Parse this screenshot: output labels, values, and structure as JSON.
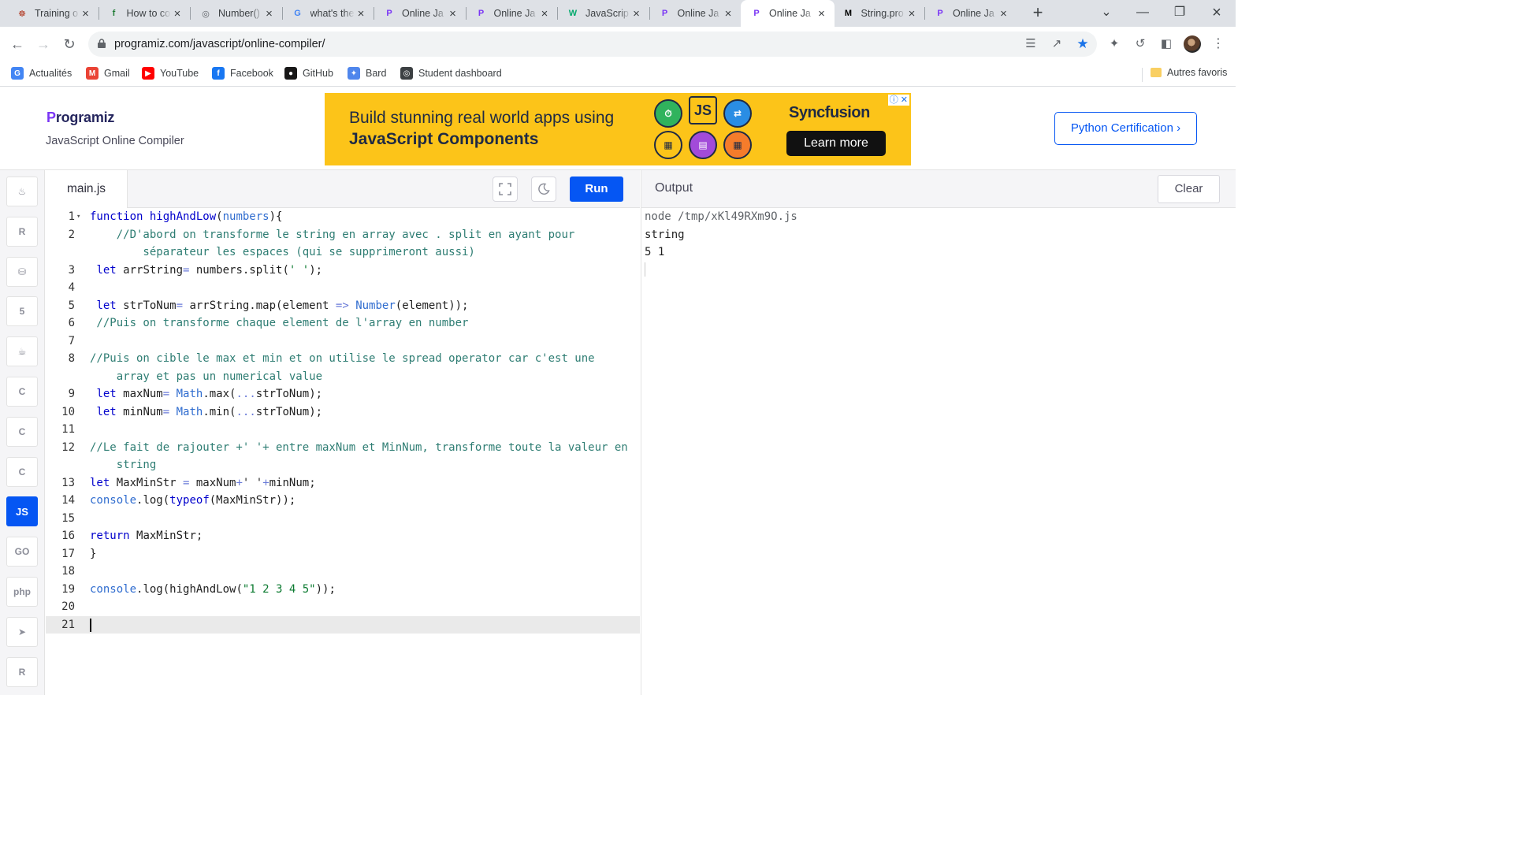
{
  "browser": {
    "tabs": [
      {
        "title": "Training o",
        "icon": "codewars-icon",
        "color": "#b1361e",
        "glyph": "☸"
      },
      {
        "title": "How to co",
        "icon": "freecodecamp-icon",
        "color": "#1e7b34",
        "glyph": "f"
      },
      {
        "title": "Number()",
        "icon": "globe-icon",
        "color": "#5f6368",
        "glyph": "◎"
      },
      {
        "title": "what's the",
        "icon": "google-icon",
        "color": "#4285f4",
        "glyph": "G"
      },
      {
        "title": "Online Ja",
        "icon": "programiz-icon",
        "color": "#7a35f5",
        "glyph": "P"
      },
      {
        "title": "Online Ja",
        "icon": "programiz-icon",
        "color": "#7a35f5",
        "glyph": "P"
      },
      {
        "title": "JavaScrip",
        "icon": "w3schools-icon",
        "color": "#04aa6d",
        "glyph": "W"
      },
      {
        "title": "Online Ja",
        "icon": "programiz-icon",
        "color": "#7a35f5",
        "glyph": "P"
      },
      {
        "title": "Online Ja",
        "icon": "programiz-icon",
        "color": "#7a35f5",
        "glyph": "P",
        "active": true
      },
      {
        "title": "String.pro",
        "icon": "mdn-icon",
        "color": "#000000",
        "glyph": "M"
      },
      {
        "title": "Online Ja",
        "icon": "programiz-icon",
        "color": "#7a35f5",
        "glyph": "P"
      }
    ],
    "url": "programiz.com/javascript/online-compiler/",
    "bookmarks": [
      {
        "label": "Actualités",
        "icon": "google-news-icon",
        "color": "#4285f4",
        "glyph": "G"
      },
      {
        "label": "Gmail",
        "icon": "gmail-icon",
        "color": "#ea4335",
        "glyph": "M"
      },
      {
        "label": "YouTube",
        "icon": "youtube-icon",
        "color": "#ff0000",
        "glyph": "▶"
      },
      {
        "label": "Facebook",
        "icon": "facebook-icon",
        "color": "#1877f2",
        "glyph": "f"
      },
      {
        "label": "GitHub",
        "icon": "github-icon",
        "color": "#181717",
        "glyph": "●"
      },
      {
        "label": "Bard",
        "icon": "bard-icon",
        "color": "#4f86ec",
        "glyph": "✦"
      },
      {
        "label": "Student dashboard",
        "icon": "globe-icon",
        "color": "#3c4043",
        "glyph": "◎"
      }
    ],
    "other_bookmarks": "Autres favoris"
  },
  "header": {
    "logo": "rogramiz",
    "logo_p": "P",
    "subtitle": "JavaScript Online Compiler",
    "certification_button": "Python Certification ›"
  },
  "ad": {
    "line1": "Build stunning real world apps using",
    "line2": "JavaScript Components",
    "brand": "Syncfusion",
    "cta": "Learn more",
    "js_badge": "JS"
  },
  "languages": [
    {
      "name": "python-icon",
      "glyph": "♨"
    },
    {
      "name": "r-icon",
      "glyph": "R"
    },
    {
      "name": "sql-icon",
      "glyph": "⛁"
    },
    {
      "name": "html-icon",
      "glyph": "5"
    },
    {
      "name": "java-icon",
      "glyph": "☕"
    },
    {
      "name": "c-icon",
      "glyph": "C"
    },
    {
      "name": "cpp-icon",
      "glyph": "C"
    },
    {
      "name": "csharp-icon",
      "glyph": "C"
    },
    {
      "name": "javascript-icon",
      "glyph": "JS",
      "active": true
    },
    {
      "name": "go-icon",
      "glyph": "GO"
    },
    {
      "name": "php-icon",
      "glyph": "php"
    },
    {
      "name": "swift-icon",
      "glyph": "➤"
    },
    {
      "name": "rust-icon",
      "glyph": "R"
    }
  ],
  "editor": {
    "filename": "main.js",
    "run_label": "Run",
    "lines": [
      {
        "n": "1",
        "fold": true,
        "rows": [
          [
            [
              "kw",
              "function "
            ],
            [
              "fn",
              "highAndLow"
            ],
            [
              "p",
              "("
            ],
            [
              "var",
              "numbers"
            ],
            [
              "p",
              "){"
            ]
          ]
        ]
      },
      {
        "n": "2",
        "rows": [
          [
            [
              "cm",
              "    //D'abord on transforme le string en array avec . split en ayant pour"
            ]
          ],
          [
            [
              "cm",
              "        séparateur les espaces (qui se supprimeront aussi)"
            ]
          ]
        ]
      },
      {
        "n": "3",
        "rows": [
          [
            [
              "p",
              " "
            ],
            [
              "kw",
              "let "
            ],
            [
              "p",
              "arrString"
            ],
            [
              "op",
              "= "
            ],
            [
              "p",
              "numbers.split("
            ],
            [
              "str",
              "' '"
            ],
            [
              "p",
              ");"
            ]
          ]
        ]
      },
      {
        "n": "4",
        "rows": [
          [
            [
              "p",
              ""
            ]
          ]
        ]
      },
      {
        "n": "5",
        "rows": [
          [
            [
              "p",
              " "
            ],
            [
              "kw",
              "let "
            ],
            [
              "p",
              "strToNum"
            ],
            [
              "op",
              "= "
            ],
            [
              "p",
              "arrString.map(element "
            ],
            [
              "op",
              "=> "
            ],
            [
              "bi",
              "Number"
            ],
            [
              "p",
              "(element));"
            ]
          ]
        ]
      },
      {
        "n": "6",
        "rows": [
          [
            [
              "cm",
              " //Puis on transforme chaque element de l'array en number"
            ]
          ]
        ]
      },
      {
        "n": "7",
        "rows": [
          [
            [
              "p",
              ""
            ]
          ]
        ]
      },
      {
        "n": "8",
        "rows": [
          [
            [
              "cm",
              "//Puis on cible le max et min et on utilise le spread operator car c'est une"
            ]
          ],
          [
            [
              "cm",
              "    array et pas un numerical value"
            ]
          ]
        ]
      },
      {
        "n": "9",
        "rows": [
          [
            [
              "p",
              " "
            ],
            [
              "kw",
              "let "
            ],
            [
              "p",
              "maxNum"
            ],
            [
              "op",
              "= "
            ],
            [
              "bi",
              "Math"
            ],
            [
              "p",
              ".max("
            ],
            [
              "op",
              "..."
            ],
            [
              "p",
              "strToNum);"
            ]
          ]
        ]
      },
      {
        "n": "10",
        "rows": [
          [
            [
              "p",
              " "
            ],
            [
              "kw",
              "let "
            ],
            [
              "p",
              "minNum"
            ],
            [
              "op",
              "= "
            ],
            [
              "bi",
              "Math"
            ],
            [
              "p",
              ".min("
            ],
            [
              "op",
              "..."
            ],
            [
              "p",
              "strToNum);"
            ]
          ]
        ]
      },
      {
        "n": "11",
        "rows": [
          [
            [
              "p",
              ""
            ]
          ]
        ]
      },
      {
        "n": "12",
        "rows": [
          [
            [
              "cm",
              "//Le fait de rajouter +' '+ entre maxNum et MinNum, transforme toute la valeur en"
            ]
          ],
          [
            [
              "cm",
              "    string"
            ]
          ]
        ]
      },
      {
        "n": "13",
        "rows": [
          [
            [
              "kw",
              "let "
            ],
            [
              "p",
              "MaxMinStr "
            ],
            [
              "op",
              "= "
            ],
            [
              "p",
              "maxNum"
            ],
            [
              "op",
              "+"
            ],
            [
              "p",
              "' '"
            ],
            [
              "op",
              "+"
            ],
            [
              "p",
              "minNum;"
            ]
          ]
        ]
      },
      {
        "n": "14",
        "rows": [
          [
            [
              "bi",
              "console"
            ],
            [
              "p",
              ".log("
            ],
            [
              "kw",
              "typeof"
            ],
            [
              "p",
              "(MaxMinStr));"
            ]
          ]
        ]
      },
      {
        "n": "15",
        "rows": [
          [
            [
              "p",
              ""
            ]
          ]
        ]
      },
      {
        "n": "16",
        "rows": [
          [
            [
              "kw",
              "return "
            ],
            [
              "p",
              "MaxMinStr;"
            ]
          ]
        ]
      },
      {
        "n": "17",
        "rows": [
          [
            [
              "p",
              "}"
            ]
          ]
        ]
      },
      {
        "n": "18",
        "rows": [
          [
            [
              "p",
              ""
            ]
          ]
        ]
      },
      {
        "n": "19",
        "rows": [
          [
            [
              "bi",
              "console"
            ],
            [
              "p",
              ".log(highAndLow("
            ],
            [
              "str",
              "\"1 2 3 4 5\""
            ],
            [
              "p",
              "));"
            ]
          ]
        ]
      },
      {
        "n": "20",
        "rows": [
          [
            [
              "p",
              ""
            ]
          ]
        ]
      },
      {
        "n": "21",
        "current": true,
        "rows": [
          [
            [
              "p",
              ""
            ]
          ]
        ]
      }
    ]
  },
  "output": {
    "title": "Output",
    "clear_label": "Clear",
    "lines": [
      "node /tmp/xKl49RXm9O.js",
      "string",
      "5 1"
    ]
  },
  "colors": {
    "accent": "#0556f3",
    "keyword": "#0000cc",
    "comment": "#2e7d73",
    "string": "#0b7a30",
    "builtin": "#2f6ccf",
    "operator": "#6a7bd8"
  }
}
